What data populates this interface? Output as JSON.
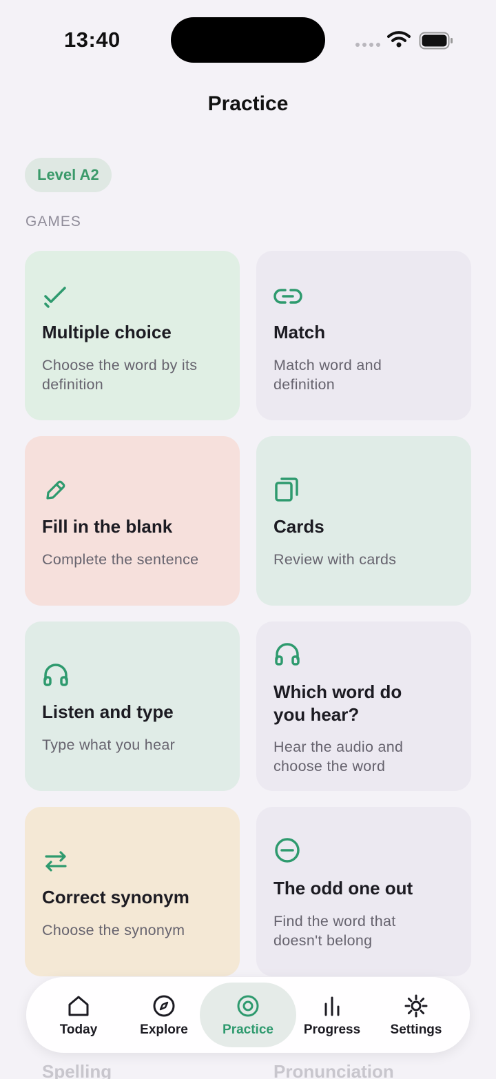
{
  "status_bar": {
    "time": "13:40"
  },
  "header": {
    "title": "Practice"
  },
  "level_badge": "Level A2",
  "section_label": "GAMES",
  "cards": [
    {
      "title": "Multiple choice",
      "desc": "Choose the word by its definition",
      "icon": "checkmark-icon"
    },
    {
      "title": "Match",
      "desc": "Match word and definition",
      "icon": "link-icon"
    },
    {
      "title": "Fill in the blank",
      "desc": "Complete the sentence",
      "icon": "pencil-icon"
    },
    {
      "title": "Cards",
      "desc": "Review with cards",
      "icon": "cards-icon"
    },
    {
      "title": "Listen and type",
      "desc": "Type what you hear",
      "icon": "headphones-icon"
    },
    {
      "title": "Which word do you hear?",
      "desc": "Hear the audio and choose the word",
      "icon": "headphones-icon"
    },
    {
      "title": "Correct synonym",
      "desc": "Choose the synonym",
      "icon": "swap-arrows-icon"
    },
    {
      "title": "The odd one out",
      "desc": "Find the word that doesn't belong",
      "icon": "minus-circle-icon"
    }
  ],
  "peek_cards": [
    "Spelling",
    "Pronunciation"
  ],
  "tabs": [
    {
      "label": "Today",
      "icon": "home-icon"
    },
    {
      "label": "Explore",
      "icon": "compass-icon"
    },
    {
      "label": "Practice",
      "icon": "target-icon",
      "active": true
    },
    {
      "label": "Progress",
      "icon": "bar-chart-icon"
    },
    {
      "label": "Settings",
      "icon": "gear-icon"
    }
  ],
  "colors": {
    "accent": "#2e9a6e",
    "background": "#f4f2f7"
  }
}
